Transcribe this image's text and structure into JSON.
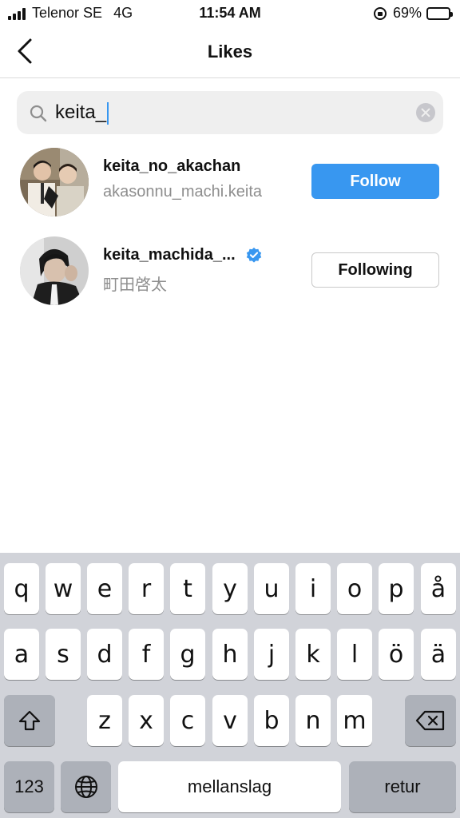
{
  "status": {
    "carrier": "Telenor SE",
    "network": "4G",
    "time": "11:54 AM",
    "battery_percent": "69%",
    "battery_level": 0.69
  },
  "header": {
    "title": "Likes",
    "back_icon": "chevron-left-icon"
  },
  "search": {
    "query": "keita_",
    "icon": "search-icon",
    "clear_icon": "clear-icon"
  },
  "results": [
    {
      "username": "keita_no_akachan",
      "subtitle": "akasonnu_machi.keita",
      "verified": false,
      "button": "Follow",
      "button_style": "primary"
    },
    {
      "username": "keita_machida_...",
      "subtitle": "町田啓太",
      "verified": true,
      "button": "Following",
      "button_style": "secondary"
    }
  ],
  "keyboard": {
    "row1": [
      "q",
      "w",
      "e",
      "r",
      "t",
      "y",
      "u",
      "i",
      "o",
      "p",
      "å"
    ],
    "row2": [
      "a",
      "s",
      "d",
      "f",
      "g",
      "h",
      "j",
      "k",
      "l",
      "ö",
      "ä"
    ],
    "row3": [
      "z",
      "x",
      "c",
      "v",
      "b",
      "n",
      "m"
    ],
    "numbers_label": "123",
    "space_label": "mellanslag",
    "return_label": "retur",
    "shift_icon": "shift-icon",
    "delete_icon": "backspace-icon",
    "globe_icon": "globe-icon"
  },
  "colors": {
    "follow_blue": "#3897f0",
    "verified_blue": "#3897f0",
    "keyboard_bg": "#d1d3d9"
  }
}
